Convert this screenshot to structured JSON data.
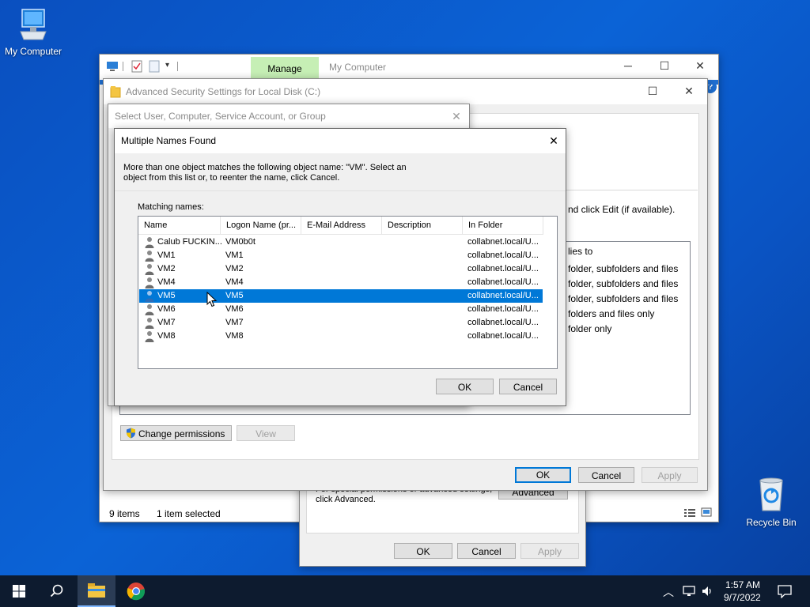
{
  "desktop": {
    "my_computer_label": "My Computer",
    "recycle_bin_label": "Recycle Bin"
  },
  "explorer": {
    "manage_tab": "Manage",
    "title": "My Computer",
    "status_items": "9 items",
    "status_selected": "1 item selected"
  },
  "advanced_security": {
    "title": "Advanced Security Settings for Local Disk (C:)",
    "right_text_1": "nd click Edit (if available).",
    "applies_header": "lies to",
    "applies": [
      "folder, subfolders and files",
      "folder, subfolders and files",
      "folder, subfolders and files",
      "folders and files only",
      "folder only"
    ],
    "change_permissions": "Change permissions",
    "view": "View",
    "ok": "OK",
    "cancel": "Cancel",
    "apply": "Apply"
  },
  "properties": {
    "partial_text": "For special permissions or advanced settings,",
    "click_advanced": "click Advanced.",
    "advanced_button": "Advanced",
    "ok": "OK",
    "cancel": "Cancel",
    "apply": "Apply"
  },
  "select_user": {
    "title": "Select User, Computer, Service Account, or Group"
  },
  "multiple_names": {
    "title": "Multiple Names Found",
    "message_line1": "More than one object matches the following object name: \"VM\". Select an",
    "message_line2": "object from this list or, to reenter the name, click Cancel.",
    "matching_label": "Matching names:",
    "columns": [
      "Name",
      "Logon Name (pr...",
      "E-Mail Address",
      "Description",
      "In Folder"
    ],
    "rows": [
      {
        "name": "Calub FUCKIN...",
        "logon": "VM0b0t",
        "folder": "collabnet.local/U..."
      },
      {
        "name": "VM1",
        "logon": "VM1",
        "folder": "collabnet.local/U..."
      },
      {
        "name": "VM2",
        "logon": "VM2",
        "folder": "collabnet.local/U..."
      },
      {
        "name": "VM4",
        "logon": "VM4",
        "folder": "collabnet.local/U..."
      },
      {
        "name": "VM5",
        "logon": "VM5",
        "folder": "collabnet.local/U..."
      },
      {
        "name": "VM6",
        "logon": "VM6",
        "folder": "collabnet.local/U..."
      },
      {
        "name": "VM7",
        "logon": "VM7",
        "folder": "collabnet.local/U..."
      },
      {
        "name": "VM8",
        "logon": "VM8",
        "folder": "collabnet.local/U..."
      }
    ],
    "selected_row": "VM5",
    "ok": "OK",
    "cancel": "Cancel"
  },
  "taskbar": {
    "time": "1:57 AM",
    "date": "9/7/2022"
  },
  "colors": {
    "selection": "#0078d7",
    "taskbar": "#0d1b2f",
    "manage_tab": "#c6efb5"
  }
}
